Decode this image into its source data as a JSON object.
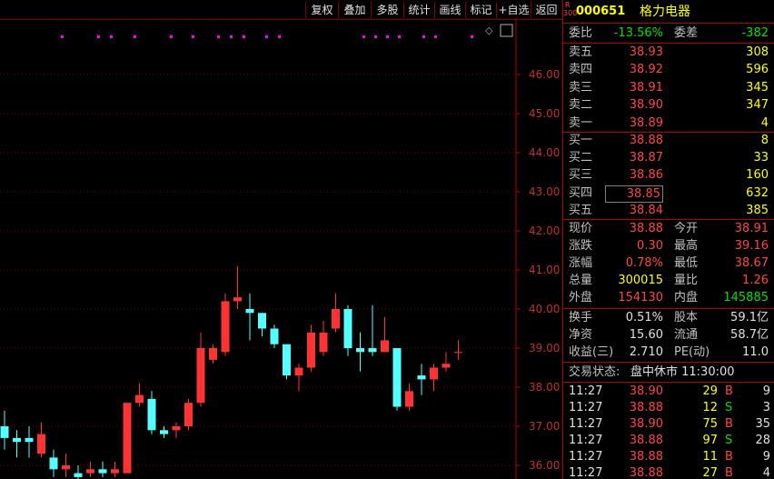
{
  "toolbar": {
    "buttons": [
      "复权",
      "叠加",
      "多股",
      "统计",
      "画线",
      "标记",
      "+自选",
      "返回"
    ]
  },
  "chart": {
    "price_ticks": [
      "46.00",
      "45.00",
      "44.00",
      "43.00",
      "42.00",
      "41.00",
      "40.00",
      "39.00",
      "38.00",
      "37.00",
      "36.00"
    ],
    "diamond_glyph": "◇",
    "up_color": "#ff3333",
    "down_color": "#54ffff"
  },
  "chart_data": {
    "type": "candlestick",
    "ylim": [
      35.7,
      47.0
    ],
    "up_color": "#ff3333",
    "down_color": "#54ffff",
    "candles": [
      {
        "o": 37.0,
        "c": 36.7,
        "h": 37.4,
        "l": 36.4
      },
      {
        "o": 36.7,
        "c": 36.6,
        "h": 36.9,
        "l": 36.2
      },
      {
        "o": 36.7,
        "c": 36.6,
        "h": 37.0,
        "l": 36.2
      },
      {
        "o": 36.3,
        "c": 36.8,
        "h": 37.1,
        "l": 36.2
      },
      {
        "o": 36.2,
        "c": 35.9,
        "h": 36.4,
        "l": 35.7
      },
      {
        "o": 35.9,
        "c": 36.0,
        "h": 36.3,
        "l": 35.7
      },
      {
        "o": 35.8,
        "c": 35.7,
        "h": 36.0,
        "l": 35.6
      },
      {
        "o": 35.8,
        "c": 35.9,
        "h": 36.1,
        "l": 35.7
      },
      {
        "o": 35.9,
        "c": 35.8,
        "h": 36.1,
        "l": 35.7
      },
      {
        "o": 35.8,
        "c": 35.9,
        "h": 36.1,
        "l": 35.7
      },
      {
        "o": 35.8,
        "c": 37.6,
        "h": 37.6,
        "l": 35.8
      },
      {
        "o": 37.6,
        "c": 37.8,
        "h": 38.1,
        "l": 37.5
      },
      {
        "o": 37.7,
        "c": 36.9,
        "h": 37.9,
        "l": 36.8
      },
      {
        "o": 36.9,
        "c": 36.8,
        "h": 37.0,
        "l": 36.7
      },
      {
        "o": 36.9,
        "c": 37.0,
        "h": 37.1,
        "l": 36.7
      },
      {
        "o": 37.0,
        "c": 37.6,
        "h": 37.7,
        "l": 36.9
      },
      {
        "o": 37.6,
        "c": 39.0,
        "h": 39.4,
        "l": 37.5
      },
      {
        "o": 38.7,
        "c": 39.0,
        "h": 39.1,
        "l": 38.6
      },
      {
        "o": 38.9,
        "c": 40.2,
        "h": 40.4,
        "l": 38.8
      },
      {
        "o": 40.2,
        "c": 40.3,
        "h": 41.1,
        "l": 40.0
      },
      {
        "o": 40.0,
        "c": 39.9,
        "h": 40.4,
        "l": 39.2
      },
      {
        "o": 39.9,
        "c": 39.5,
        "h": 39.9,
        "l": 39.3
      },
      {
        "o": 39.5,
        "c": 39.1,
        "h": 39.6,
        "l": 39.0
      },
      {
        "o": 39.1,
        "c": 38.3,
        "h": 39.1,
        "l": 38.2
      },
      {
        "o": 38.3,
        "c": 38.5,
        "h": 38.6,
        "l": 37.9
      },
      {
        "o": 38.5,
        "c": 39.4,
        "h": 39.6,
        "l": 38.4
      },
      {
        "o": 38.9,
        "c": 39.4,
        "h": 39.7,
        "l": 38.8
      },
      {
        "o": 39.5,
        "c": 40.0,
        "h": 40.4,
        "l": 39.4
      },
      {
        "o": 40.0,
        "c": 39.0,
        "h": 40.1,
        "l": 38.8
      },
      {
        "o": 39.0,
        "c": 38.9,
        "h": 39.4,
        "l": 38.4
      },
      {
        "o": 39.0,
        "c": 38.9,
        "h": 40.1,
        "l": 38.8
      },
      {
        "o": 38.9,
        "c": 39.2,
        "h": 39.8,
        "l": 38.9
      },
      {
        "o": 39.0,
        "c": 37.5,
        "h": 39.0,
        "l": 37.4
      },
      {
        "o": 37.5,
        "c": 37.9,
        "h": 38.1,
        "l": 37.4
      },
      {
        "o": 38.3,
        "c": 38.2,
        "h": 38.6,
        "l": 37.8
      },
      {
        "o": 38.2,
        "c": 38.5,
        "h": 38.6,
        "l": 37.9
      },
      {
        "o": 38.5,
        "c": 38.6,
        "h": 38.9,
        "l": 38.4
      },
      {
        "o": 38.9,
        "c": 38.9,
        "h": 39.2,
        "l": 38.7
      }
    ]
  },
  "quote": {
    "code_badge_top": "R",
    "code_badge_bottom": "300",
    "code": "000651",
    "name": "格力电器",
    "weibi_label": "委比",
    "weibi_value": "-13.56%",
    "weicha_label": "委差",
    "weicha_value": "-382",
    "sells": [
      {
        "label": "卖五",
        "price": "38.93",
        "vol": "308"
      },
      {
        "label": "卖四",
        "price": "38.92",
        "vol": "596"
      },
      {
        "label": "卖三",
        "price": "38.91",
        "vol": "345"
      },
      {
        "label": "卖二",
        "price": "38.90",
        "vol": "347"
      },
      {
        "label": "卖一",
        "price": "38.89",
        "vol": "4"
      }
    ],
    "buys": [
      {
        "label": "买一",
        "price": "38.88",
        "vol": "8"
      },
      {
        "label": "买二",
        "price": "38.87",
        "vol": "33"
      },
      {
        "label": "买三",
        "price": "38.86",
        "vol": "160"
      },
      {
        "label": "买四",
        "price": "38.85",
        "vol": "632"
      },
      {
        "label": "买五",
        "price": "38.84",
        "vol": "385"
      }
    ],
    "stats": {
      "xianjia_label": "现价",
      "xianjia": "38.88",
      "jinkai_label": "今开",
      "jinkai": "38.91",
      "zhangdie_label": "涨跌",
      "zhangdie": "0.30",
      "zuigao_label": "最高",
      "zuigao": "39.16",
      "zhangfu_label": "涨幅",
      "zhangfu": "0.78%",
      "zuidi_label": "最低",
      "zuidi": "38.67",
      "zongliang_label": "总量",
      "zongliang": "300015",
      "liangbi_label": "量比",
      "liangbi": "1.26",
      "waipan_label": "外盘",
      "waipan": "154130",
      "neipan_label": "内盘",
      "neipan": "145885",
      "huanshou_label": "换手",
      "huanshou": "0.51%",
      "guben_label": "股本",
      "guben": "59.1亿",
      "jingzi_label": "净资",
      "jingzi": "15.60",
      "liutong_label": "流通",
      "liutong": "58.7亿",
      "shouyi_label": "收益(三)",
      "shouyi": "2.710",
      "pe_label": "PE(动)",
      "pe": "11.0"
    },
    "status_label": "交易状态:",
    "status_value": "盘中休市 11:30:00",
    "ticks": [
      {
        "time": "11:27",
        "price": "38.90",
        "vol": "29",
        "bs": "B",
        "n": "9"
      },
      {
        "time": "11:27",
        "price": "38.88",
        "vol": "12",
        "bs": "S",
        "n": "3"
      },
      {
        "time": "11:27",
        "price": "38.90",
        "vol": "75",
        "bs": "B",
        "n": "35"
      },
      {
        "time": "11:27",
        "price": "38.88",
        "vol": "97",
        "bs": "S",
        "n": "28"
      },
      {
        "time": "11:27",
        "price": "38.88",
        "vol": "11",
        "bs": "B",
        "n": "9"
      },
      {
        "time": "11:27",
        "price": "38.88",
        "vol": "27",
        "bs": "B",
        "n": "4"
      }
    ]
  }
}
